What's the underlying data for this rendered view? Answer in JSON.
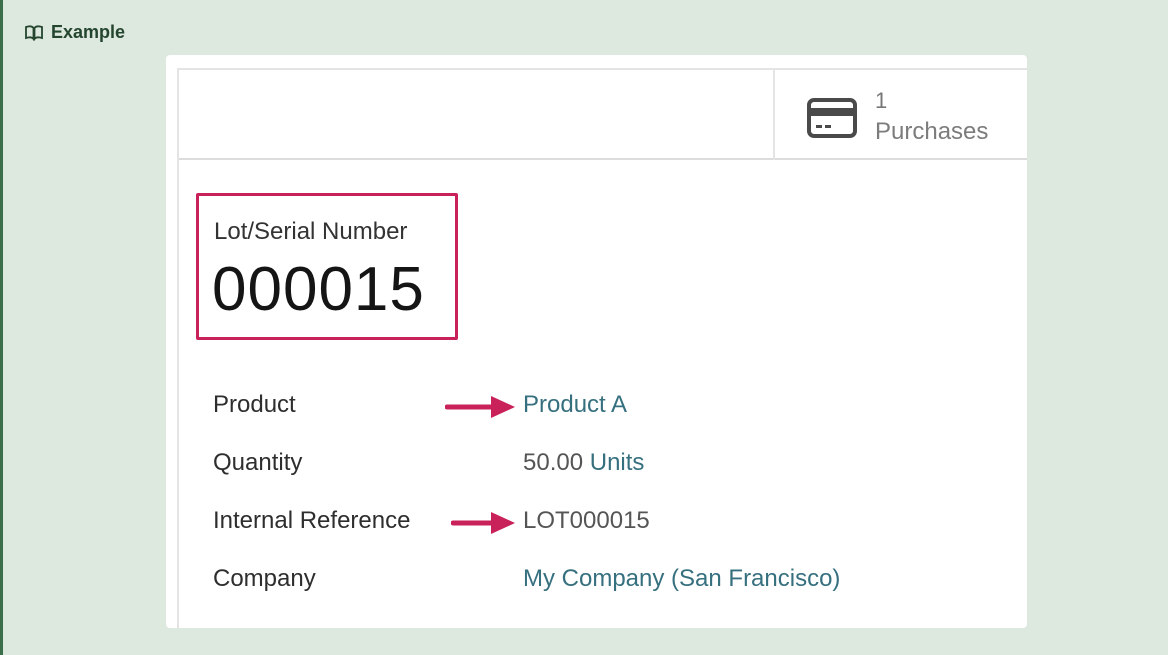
{
  "admonition": {
    "title": "Example",
    "icon": "book-icon"
  },
  "header": {
    "smart_button": {
      "icon": "credit-card-icon",
      "count": "1",
      "label": "Purchases"
    }
  },
  "lot": {
    "label": "Lot/Serial Number",
    "value": "000015"
  },
  "fields": {
    "product": {
      "label": "Product",
      "value": "Product A"
    },
    "quantity": {
      "label": "Quantity",
      "amount": "50.00",
      "unit": "Units"
    },
    "internal_reference": {
      "label": "Internal Reference",
      "value": "LOT000015"
    },
    "company": {
      "label": "Company",
      "value": "My Company (San Francisco)"
    }
  },
  "colors": {
    "highlight": "#c9215a",
    "link": "#36707f",
    "admonition_bg": "#dde8df",
    "admonition_accent": "#3b6e4a"
  }
}
